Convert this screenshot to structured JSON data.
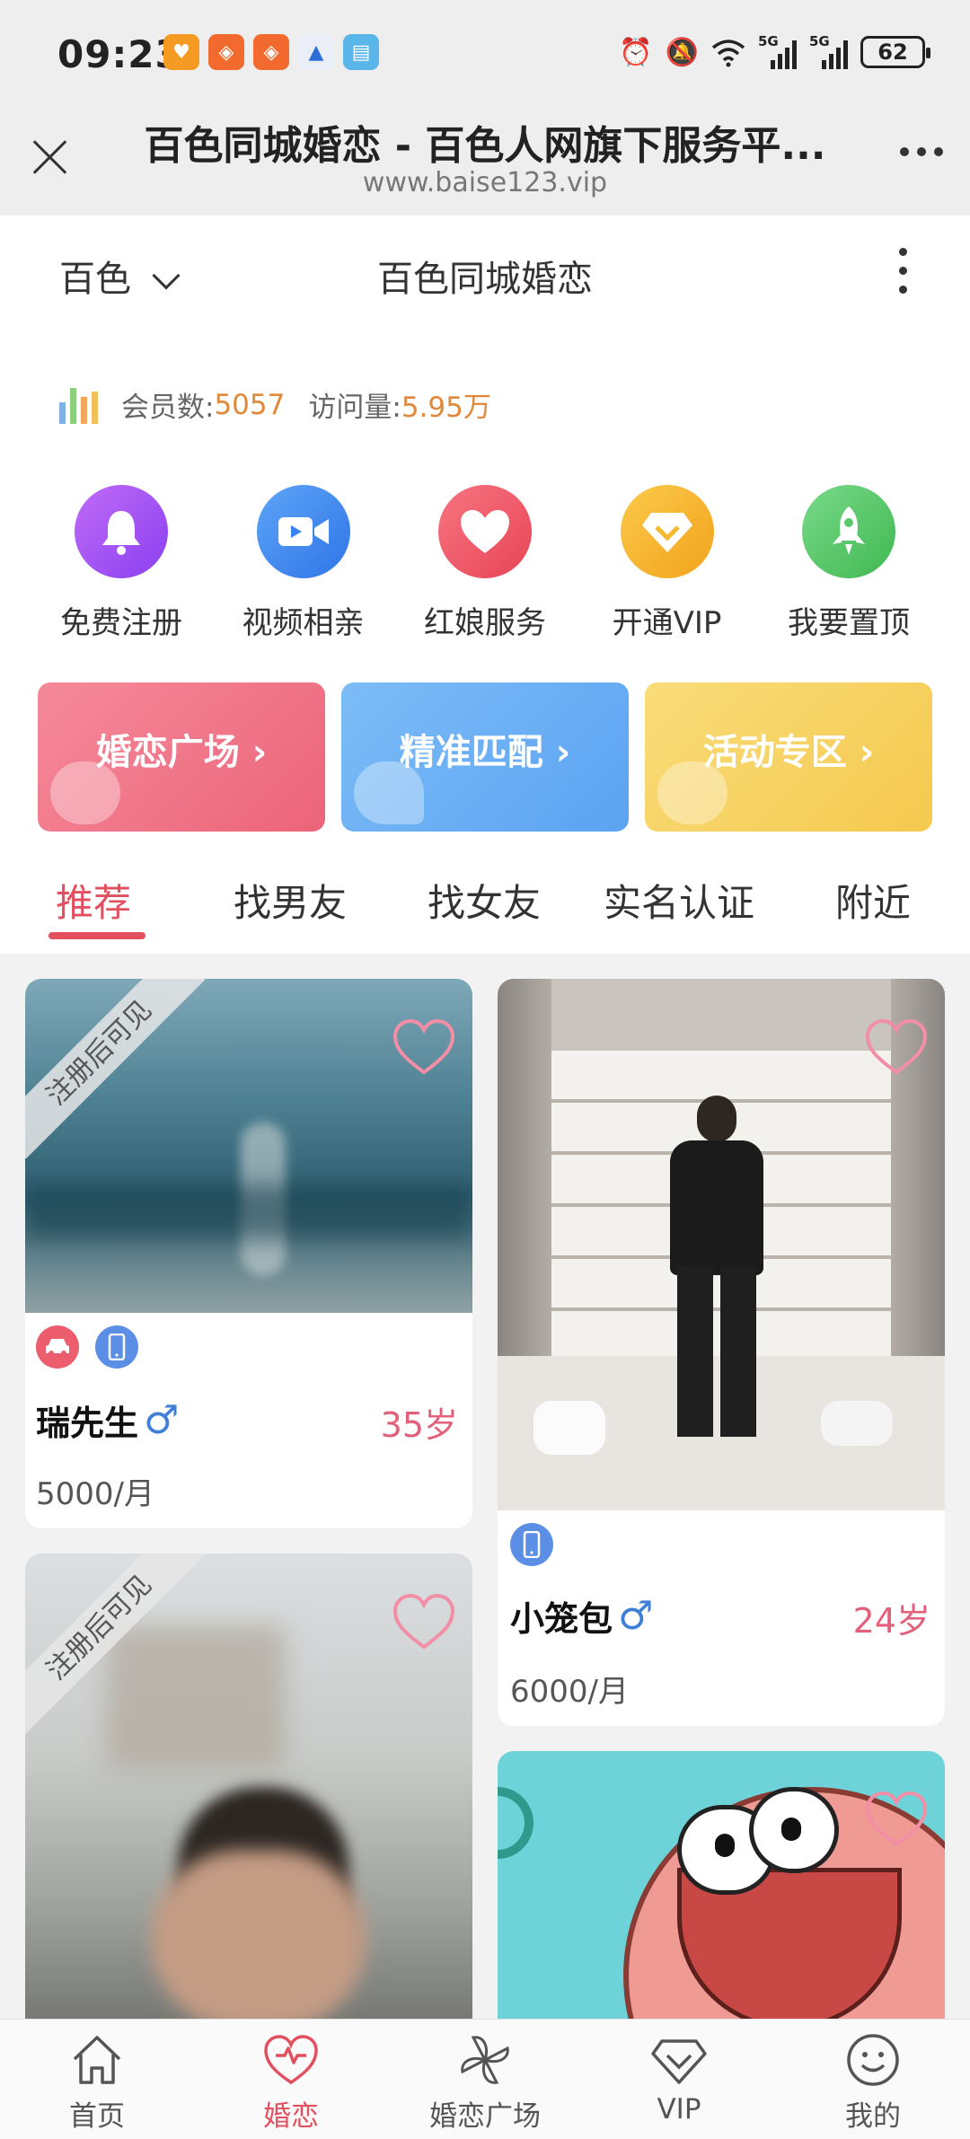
{
  "status_bar": {
    "time": "09:23",
    "battery": "62",
    "signal_label": "5G"
  },
  "browser": {
    "title": "百色同城婚恋 - 百色人网旗下服务平...",
    "url": "www.baise123.vip"
  },
  "header": {
    "city": "百色",
    "site_name": "百色同城婚恋"
  },
  "stats": {
    "members_label": "会员数:",
    "members_value": "5057",
    "visits_label": "访问量:",
    "visits_value": "5.95万"
  },
  "quick_actions": [
    {
      "label": "免费注册",
      "icon": "bell-icon",
      "color": "#a855f7"
    },
    {
      "label": "视频相亲",
      "icon": "video-camera-icon",
      "color": "#3b82f6"
    },
    {
      "label": "红娘服务",
      "icon": "heart-icon",
      "color": "#f05a68"
    },
    {
      "label": "开通VIP",
      "icon": "diamond-icon",
      "color": "#f5b82e"
    },
    {
      "label": "我要置顶",
      "icon": "rocket-icon",
      "color": "#5cc96a"
    }
  ],
  "banners": [
    {
      "label": "婚恋广场 ›",
      "color": "#f07a8d"
    },
    {
      "label": "精准匹配 ›",
      "color": "#6fb3f5"
    },
    {
      "label": "活动专区 ›",
      "color": "#f7d467"
    }
  ],
  "tabs": [
    "推荐",
    "找男友",
    "找女友",
    "实名认证",
    "附近"
  ],
  "active_tab": "推荐",
  "profiles": [
    {
      "ribbon": "注册后可见",
      "name": "瑞先生",
      "gender": "♂",
      "age": "35岁",
      "income": "5000/月",
      "badges": [
        "car-icon",
        "phone-icon"
      ]
    },
    {
      "name": "小笼包",
      "gender": "♂",
      "age": "24岁",
      "income": "6000/月",
      "badges": [
        "phone-icon"
      ]
    },
    {
      "ribbon": "注册后可见"
    }
  ],
  "bottom_nav": [
    {
      "label": "首页",
      "icon": "home-icon"
    },
    {
      "label": "婚恋",
      "icon": "heart-icon"
    },
    {
      "label": "婚恋广场",
      "icon": "pinwheel-icon"
    },
    {
      "label": "VIP",
      "icon": "diamond-icon"
    },
    {
      "label": "我的",
      "icon": "smile-icon"
    }
  ],
  "active_nav": "婚恋",
  "colors": {
    "accent": "#e2505f",
    "stat_value": "#e0893a",
    "male": "#3f7fd6",
    "age": "#e2607a"
  }
}
